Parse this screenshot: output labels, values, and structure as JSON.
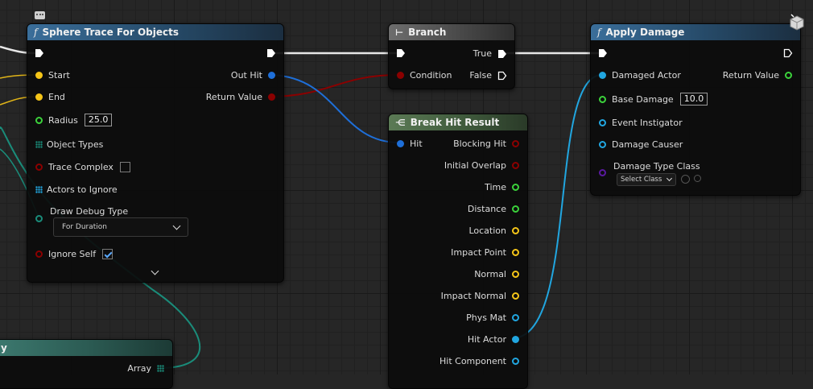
{
  "nodes": {
    "sphere_trace": {
      "title": "Sphere Trace For Objects",
      "pins": {
        "start": "Start",
        "end": "End",
        "radius": "Radius",
        "radius_value": "25.0",
        "object_types": "Object Types",
        "trace_complex": "Trace Complex",
        "actors_to_ignore": "Actors to Ignore",
        "draw_debug_type": "Draw Debug Type",
        "draw_debug_value": "For Duration",
        "ignore_self": "Ignore Self",
        "out_hit": "Out Hit",
        "return_value": "Return Value"
      }
    },
    "branch": {
      "title": "Branch",
      "pins": {
        "condition": "Condition",
        "true": "True",
        "false": "False"
      }
    },
    "break_hit": {
      "title": "Break Hit Result",
      "pins": {
        "hit": "Hit",
        "outputs": [
          "Blocking Hit",
          "Initial Overlap",
          "Time",
          "Distance",
          "Location",
          "Impact Point",
          "Normal",
          "Impact Normal",
          "Phys Mat",
          "Hit Actor",
          "Hit Component"
        ]
      }
    },
    "apply_damage": {
      "title": "Apply Damage",
      "pins": {
        "damaged_actor": "Damaged Actor",
        "base_damage": "Base Damage",
        "base_damage_value": "10.0",
        "event_instigator": "Event Instigator",
        "damage_causer": "Damage Causer",
        "damage_type_class": "Damage Type Class",
        "select_class": "Select Class",
        "return_value": "Return Value"
      }
    },
    "partial_node": {
      "title": "y",
      "pins": {
        "array": "Array"
      }
    }
  },
  "colors": {
    "exec": "#ffffff",
    "vector": "#f5c518",
    "float": "#3bd23b",
    "bool": "#8b0000",
    "struct": "#1e6fd9",
    "object": "#21a6e0",
    "class": "#5a1aa0",
    "array_wire": "#1a8c7a"
  },
  "icons": [
    "comment-icon",
    "function-icon",
    "branch-icon",
    "break-struct-icon",
    "component-cube-icon",
    "chevron-down-icon"
  ]
}
